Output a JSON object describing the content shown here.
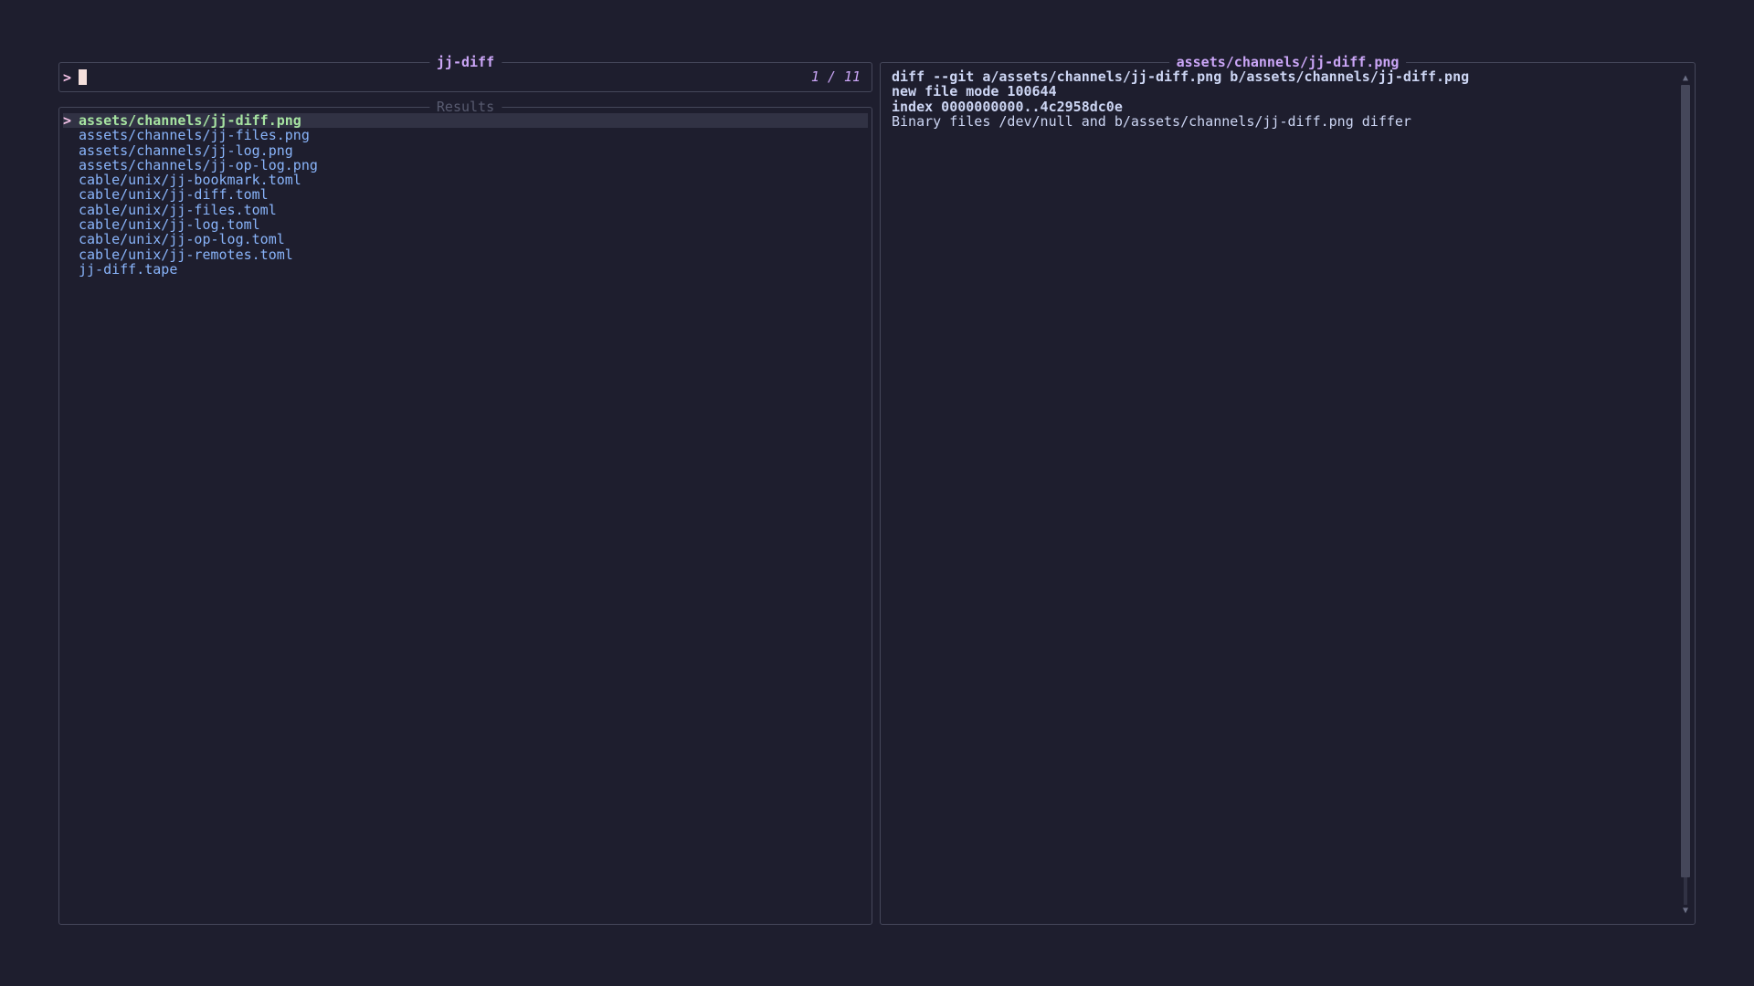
{
  "input_panel": {
    "title": "jj-diff",
    "prompt_symbol": ">",
    "query": "",
    "count": "1 / 11"
  },
  "results_panel": {
    "title": "Results",
    "selected_marker": ">",
    "items": [
      "assets/channels/jj-diff.png",
      "assets/channels/jj-files.png",
      "assets/channels/jj-log.png",
      "assets/channels/jj-op-log.png",
      "cable/unix/jj-bookmark.toml",
      "cable/unix/jj-diff.toml",
      "cable/unix/jj-files.toml",
      "cable/unix/jj-log.toml",
      "cable/unix/jj-op-log.toml",
      "cable/unix/jj-remotes.toml",
      "jj-diff.tape"
    ],
    "selected_index": 0
  },
  "preview_panel": {
    "title": "assets/channels/jj-diff.png",
    "lines": [
      "diff --git a/assets/channels/jj-diff.png b/assets/channels/jj-diff.png",
      "new file mode 100644",
      "index 0000000000..4c2958dc0e",
      "Binary files /dev/null and b/assets/channels/jj-diff.png differ"
    ],
    "bold_line_count": 3,
    "scroll_position": 0
  },
  "colors": {
    "background": "#1e1e2e",
    "border": "#45475a",
    "title": "#cba6f7",
    "result_text": "#89b4fa",
    "selected_text": "#a6e3a1",
    "selected_bg": "#313244",
    "prompt": "#f5c2e7",
    "preview_text": "#cdd6f4"
  }
}
